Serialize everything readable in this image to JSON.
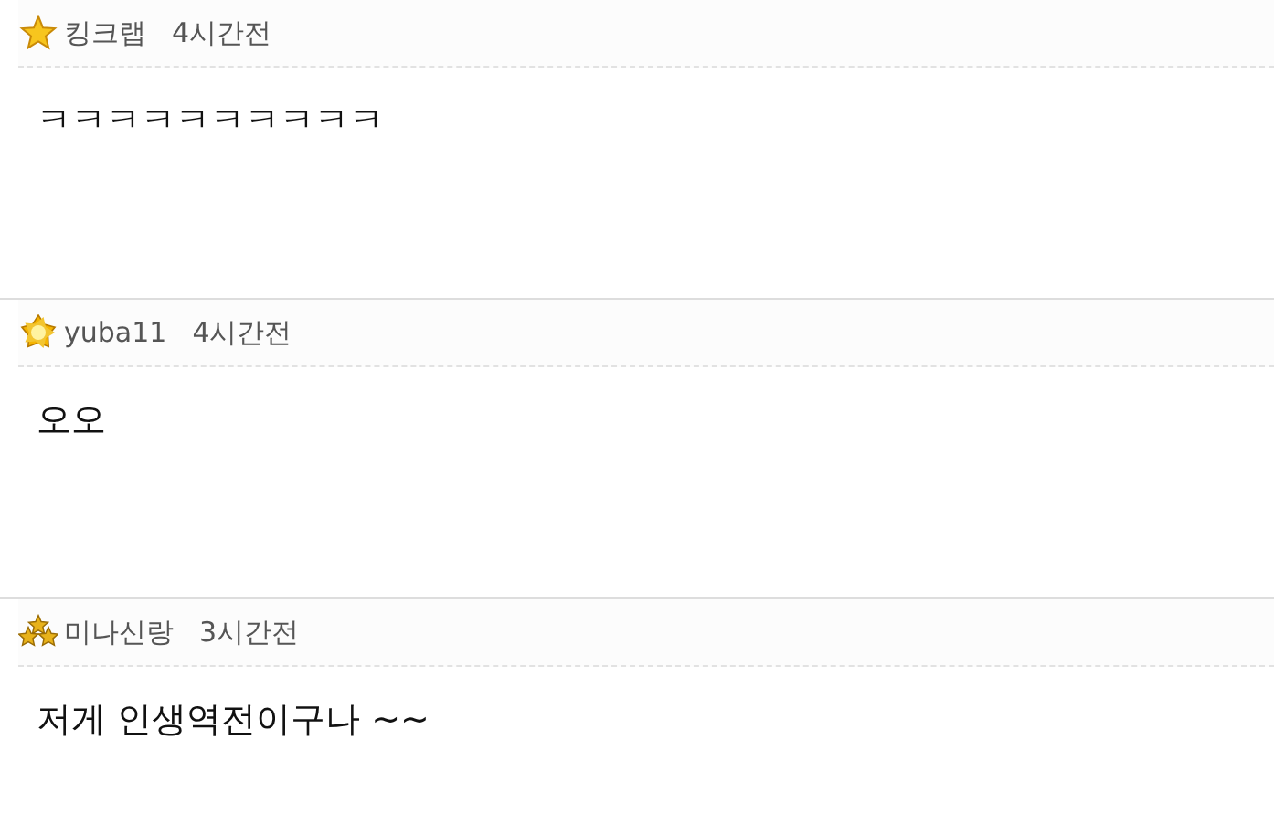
{
  "comments": [
    {
      "kind": "star",
      "author": "킹크랩",
      "time": "4시간전",
      "text": "ㅋㅋㅋㅋㅋㅋㅋㅋㅋㅋ"
    },
    {
      "kind": "sun",
      "author": "yuba11",
      "time": "4시간전",
      "text": "오오"
    },
    {
      "kind": "stars",
      "author": "미나신랑",
      "time": "3시간전",
      "text": "저게 인생역전이구나 ~~"
    }
  ]
}
